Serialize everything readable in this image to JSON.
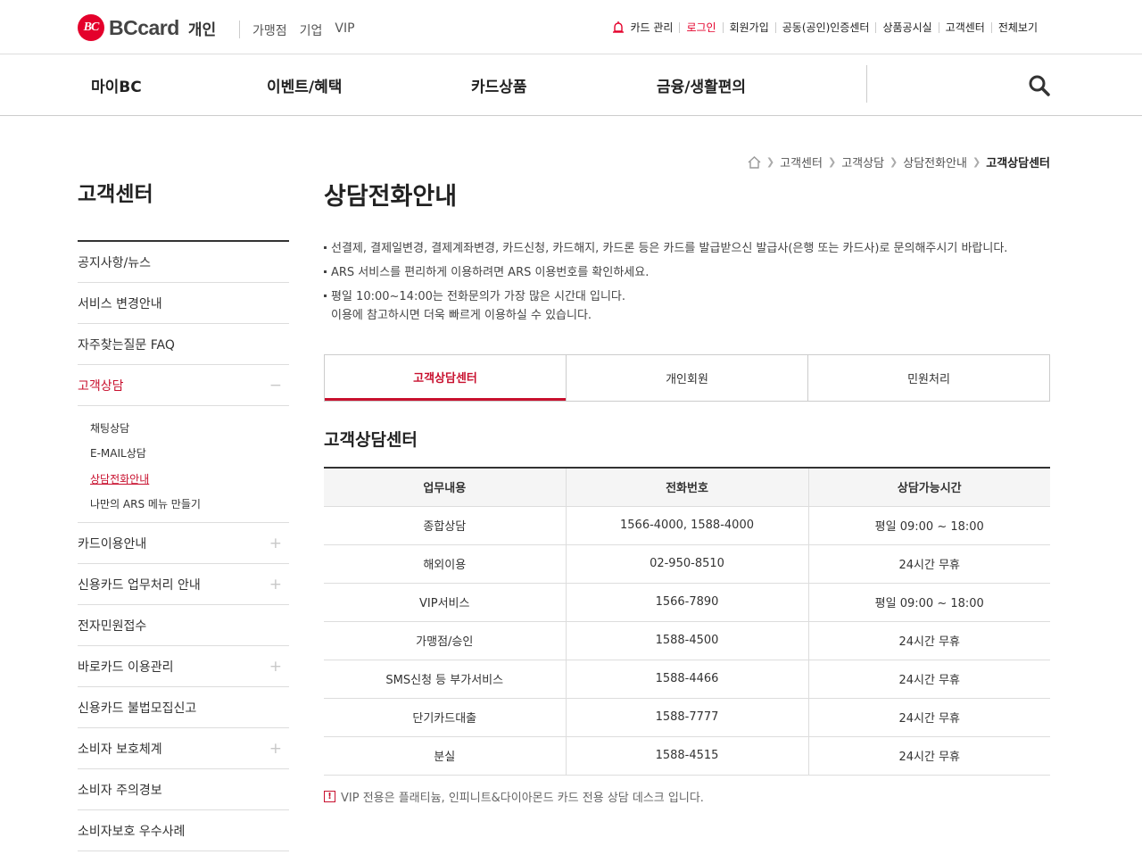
{
  "header": {
    "brand": "BCcard",
    "logo_mark": "BC",
    "section": "개인",
    "segments": [
      "가맹점",
      "기업",
      "VIP"
    ],
    "util_links": [
      "카드 관리",
      "로그인",
      "회원가입",
      "공동(공인)인증센터",
      "상품공시실",
      "고객센터",
      "전체보기"
    ],
    "util_icon": "alarm-icon",
    "accent": "#e4002b"
  },
  "gnb": {
    "items": [
      "마이BC",
      "이벤트/혜택",
      "카드상품",
      "금융/생활편의"
    ],
    "search_icon": "search-icon"
  },
  "breadcrumb": {
    "home_icon": "home-icon",
    "items": [
      "고객센터",
      "고객상담",
      "상담전화안내",
      "고객상담센터"
    ]
  },
  "sidebar": {
    "title": "고객센터",
    "items": [
      {
        "label": "공지사항/뉴스",
        "expand": ""
      },
      {
        "label": "서비스 변경안내",
        "expand": ""
      },
      {
        "label": "자주찾는질문 FAQ",
        "expand": ""
      },
      {
        "label": "고객상담",
        "expand": "−"
      },
      {
        "label": "카드이용안내",
        "expand": "+"
      },
      {
        "label": "신용카드 업무처리 안내",
        "expand": "+"
      },
      {
        "label": "전자민원접수",
        "expand": ""
      },
      {
        "label": "바로카드 이용관리",
        "expand": "+"
      },
      {
        "label": "신용카드 불법모집신고",
        "expand": ""
      },
      {
        "label": "소비자 보호체계",
        "expand": "+"
      },
      {
        "label": "소비자 주의경보",
        "expand": ""
      },
      {
        "label": "소비자보호 우수사례",
        "expand": ""
      }
    ],
    "sub_items": [
      "채팅상담",
      "E-MAIL상담",
      "상담전화안내",
      "나만의 ARS 메뉴 만들기"
    ]
  },
  "main": {
    "title": "상담전화안내",
    "notes": [
      "선결제, 결제일변경, 결제계좌변경, 카드신청, 카드해지, 카드론 등은 카드를 발급받으신 발급사(은행 또는 카드사)로 문의해주시기 바랍니다.",
      "ARS 서비스를 편리하게 이용하려면 ARS 이용번호를 확인하세요.",
      "평일 10:00~14:00는 전화문의가 가장 많은 시간대 입니다.",
      "이용에 참고하시면 더욱 빠르게 이용하실 수 있습니다."
    ],
    "tabs": [
      "고객상담센터",
      "개인회원",
      "민원처리"
    ],
    "section_title": "고객상담센터",
    "table": {
      "headers": [
        "업무내용",
        "전화번호",
        "상담가능시간"
      ],
      "rows": [
        [
          "종합상담",
          "1566-4000, 1588-4000",
          "평일 09:00 ~ 18:00"
        ],
        [
          "해외이용",
          "02-950-8510",
          "24시간 무휴"
        ],
        [
          "VIP서비스",
          "1566-7890",
          "평일 09:00 ~ 18:00"
        ],
        [
          "가맹점/승인",
          "1588-4500",
          "24시간 무휴"
        ],
        [
          "SMS신청 등 부가서비스",
          "1588-4466",
          "24시간 무휴"
        ],
        [
          "단기카드대출",
          "1588-7777",
          "24시간 무휴"
        ],
        [
          "분실",
          "1588-4515",
          "24시간 무휴"
        ]
      ]
    },
    "footnote_icon": "!",
    "footnote": "VIP 전용은 플래티늄, 인피니트&다이아몬드 카드 전용 상담 데스크 입니다."
  }
}
